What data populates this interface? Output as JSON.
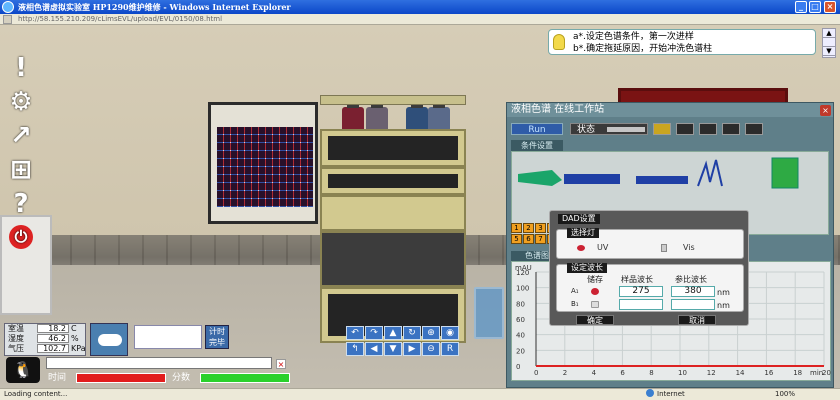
{
  "window": {
    "title": "液相色谱虚拟实验室 HP1290维护维修 - Windows Internet Explorer",
    "url": "http://58.155.210.209/cLimsEVL/upload/EVL/0150/08.html"
  },
  "tip": {
    "line1": "a*.设定色谱条件，第一次进样",
    "line2": "b*.确定拖延原因，开始冲洗色谱柱"
  },
  "panel": {
    "title": "液相色谱 在线工作站",
    "run_label": "Run",
    "status_label": "状态",
    "conditions_label": "条件设置",
    "chart_label": "色谱图",
    "keypad": [
      "1",
      "2",
      "3",
      "4",
      "5",
      "6",
      "7",
      "8"
    ]
  },
  "dialog": {
    "title": "DAD设置",
    "lamp_label": "选择灯",
    "uv_label": "UV",
    "vis_label": "Vis",
    "wave_label": "设定波长",
    "col_store": "储存",
    "col_sample": "样品波长",
    "col_ref": "参比波长",
    "row_a": "A₁",
    "row_b": "B₁",
    "sample_wavelength": "275",
    "ref_wavelength": "380",
    "unit": "nm",
    "confirm": "确定",
    "cancel": "取消"
  },
  "chart_data": {
    "type": "line",
    "ylabel": "mAU",
    "xlabel": "min",
    "ylim": [
      0,
      120
    ],
    "yticks": [
      "120",
      "100",
      "80",
      "60",
      "40",
      "20",
      "0"
    ],
    "xticks": [
      "0",
      "2",
      "4",
      "6",
      "8",
      "10",
      "12",
      "14",
      "16",
      "18",
      "20"
    ],
    "xlim": [
      0,
      20
    ],
    "series": [
      {
        "x": [
          0,
          20
        ],
        "values": [
          0,
          0
        ],
        "color": "#d22"
      }
    ]
  },
  "environment": {
    "temp_label": "室温",
    "temp_value": "18.2",
    "temp_unit": "C",
    "humidity_label": "湿度",
    "humidity_value": "46.2",
    "humidity_unit": "%",
    "pressure_label": "气压",
    "pressure_value": "102.7",
    "pressure_unit": "KPa"
  },
  "timer": {
    "button_line1": "计时",
    "button_line2": "完毕"
  },
  "progress": {
    "time_label": "时间",
    "score_label": "分数",
    "time_fraction": 1.0,
    "score_fraction": 1.0
  },
  "statusbar": {
    "left": "Loading content...",
    "zone": "Internet",
    "zoom": "100%"
  }
}
